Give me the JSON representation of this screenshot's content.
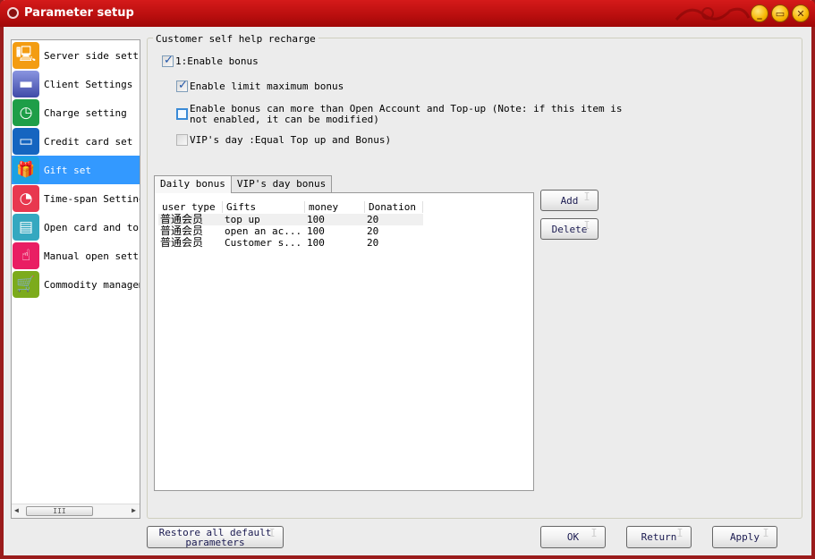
{
  "window": {
    "title": "Parameter setup",
    "controls": [
      "minimize",
      "maximize",
      "close"
    ]
  },
  "sidebar": {
    "items": [
      {
        "label": "Server side settin",
        "icon": "server-icon",
        "color": "#f39c12",
        "active": false
      },
      {
        "label": "Client Settings",
        "icon": "monitor-icon",
        "color": "#4b57b5",
        "active": false
      },
      {
        "label": "Charge setting",
        "icon": "clock-coins-icon",
        "color": "#1e9e48",
        "active": false
      },
      {
        "label": "Credit card set",
        "icon": "credit-card-icon",
        "color": "#1565c0",
        "active": false
      },
      {
        "label": "Gift set",
        "icon": "gift-icon",
        "color": "#1ba1e2",
        "active": true
      },
      {
        "label": "Time-span Setting",
        "icon": "timer-icon",
        "color": "#e8384f",
        "active": false
      },
      {
        "label": "Open card and top",
        "icon": "id-card-icon",
        "color": "#35a8c0",
        "active": false
      },
      {
        "label": "Manual open settin",
        "icon": "hand-pointer-icon",
        "color": "#e91e63",
        "active": false
      },
      {
        "label": "Commodity manageme",
        "icon": "cart-icon",
        "color": "#7cab1c",
        "active": false
      }
    ],
    "scrollbar_thumb_glyph": "III"
  },
  "group": {
    "title": "Customer self help recharge",
    "checkboxes": [
      {
        "label": "1:Enable bonus",
        "checked": true
      },
      {
        "label": "Enable limit maximum bonus",
        "checked": true
      },
      {
        "label_line1": "Enable bonus can more than Open Account and Top-up (Note: if this item is",
        "label_line2": "not enabled, it can be modified)",
        "checked": false
      },
      {
        "label": "VIP's day :Equal Top up and Bonus)",
        "checked": false
      }
    ]
  },
  "tabs": [
    {
      "label": "Daily bonus",
      "active": true
    },
    {
      "label": "VIP's day bonus",
      "active": false
    }
  ],
  "table": {
    "columns": [
      "user type",
      "Gifts category",
      "money",
      "Donation"
    ],
    "rows": [
      [
        "普通会员",
        "top up",
        "100",
        "20"
      ],
      [
        "普通会员",
        "open an ac...",
        "100",
        "20"
      ],
      [
        "普通会员",
        "Customer s...",
        "100",
        "20"
      ]
    ]
  },
  "side_buttons": {
    "add": "Add",
    "delete": "Delete"
  },
  "footer": {
    "restore_line1": "Restore all default",
    "restore_line2": "parameters",
    "ok": "OK",
    "return": "Return",
    "apply": "Apply"
  }
}
